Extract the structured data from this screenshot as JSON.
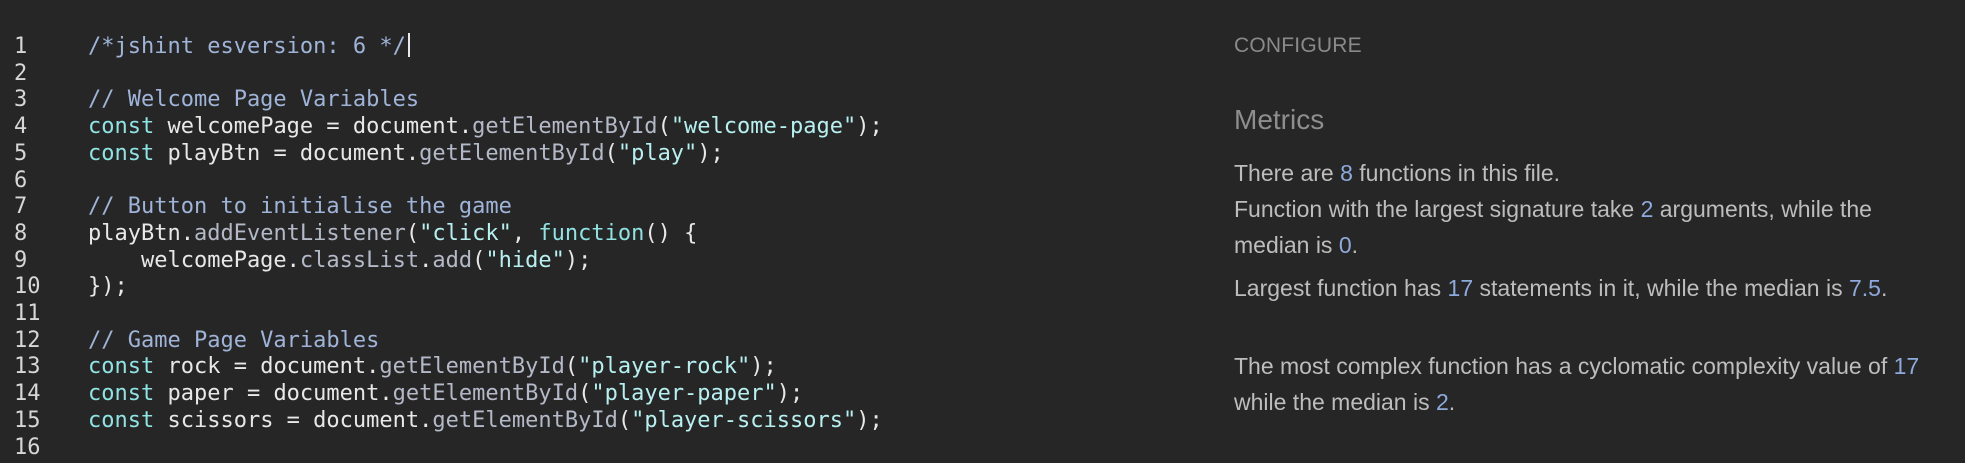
{
  "editor": {
    "lines": [
      {
        "num": "1",
        "tokens": [
          {
            "t": "/*jshint esversion: 6 */",
            "k": "comment"
          }
        ],
        "cursor": true
      },
      {
        "num": "2",
        "tokens": []
      },
      {
        "num": "3",
        "tokens": [
          {
            "t": "// Welcome Page Variables",
            "k": "comment"
          }
        ]
      },
      {
        "num": "4",
        "tokens": [
          {
            "t": "const",
            "k": "kw"
          },
          {
            "t": " welcomePage = document.",
            "k": "plain"
          },
          {
            "t": "getElementById",
            "k": "fn"
          },
          {
            "t": "(",
            "k": "plain"
          },
          {
            "t": "\"welcome-page\"",
            "k": "str"
          },
          {
            "t": ");",
            "k": "plain"
          }
        ]
      },
      {
        "num": "5",
        "tokens": [
          {
            "t": "const",
            "k": "kw"
          },
          {
            "t": " playBtn = document.",
            "k": "plain"
          },
          {
            "t": "getElementById",
            "k": "fn"
          },
          {
            "t": "(",
            "k": "plain"
          },
          {
            "t": "\"play\"",
            "k": "str"
          },
          {
            "t": ");",
            "k": "plain"
          }
        ]
      },
      {
        "num": "6",
        "tokens": []
      },
      {
        "num": "7",
        "tokens": [
          {
            "t": "// Button to initialise the game",
            "k": "comment"
          }
        ]
      },
      {
        "num": "8",
        "tokens": [
          {
            "t": "playBtn.",
            "k": "plain"
          },
          {
            "t": "addEventListener",
            "k": "fn"
          },
          {
            "t": "(",
            "k": "plain"
          },
          {
            "t": "\"click\"",
            "k": "str"
          },
          {
            "t": ", ",
            "k": "plain"
          },
          {
            "t": "function",
            "k": "kw"
          },
          {
            "t": "() {",
            "k": "plain"
          }
        ]
      },
      {
        "num": "9",
        "tokens": [
          {
            "t": "    welcomePage.",
            "k": "plain"
          },
          {
            "t": "classList",
            "k": "fn"
          },
          {
            "t": ".",
            "k": "plain"
          },
          {
            "t": "add",
            "k": "fn"
          },
          {
            "t": "(",
            "k": "plain"
          },
          {
            "t": "\"hide\"",
            "k": "str"
          },
          {
            "t": ");",
            "k": "plain"
          }
        ]
      },
      {
        "num": "10",
        "tokens": [
          {
            "t": "});",
            "k": "plain"
          }
        ]
      },
      {
        "num": "11",
        "tokens": []
      },
      {
        "num": "12",
        "tokens": [
          {
            "t": "// Game Page Variables",
            "k": "comment"
          }
        ]
      },
      {
        "num": "13",
        "tokens": [
          {
            "t": "const",
            "k": "kw"
          },
          {
            "t": " rock = document.",
            "k": "plain"
          },
          {
            "t": "getElementById",
            "k": "fn"
          },
          {
            "t": "(",
            "k": "plain"
          },
          {
            "t": "\"player-rock\"",
            "k": "str"
          },
          {
            "t": ");",
            "k": "plain"
          }
        ]
      },
      {
        "num": "14",
        "tokens": [
          {
            "t": "const",
            "k": "kw"
          },
          {
            "t": " paper = document.",
            "k": "plain"
          },
          {
            "t": "getElementById",
            "k": "fn"
          },
          {
            "t": "(",
            "k": "plain"
          },
          {
            "t": "\"player-paper\"",
            "k": "str"
          },
          {
            "t": ");",
            "k": "plain"
          }
        ]
      },
      {
        "num": "15",
        "tokens": [
          {
            "t": "const",
            "k": "kw"
          },
          {
            "t": " scissors = document.",
            "k": "plain"
          },
          {
            "t": "getElementById",
            "k": "fn"
          },
          {
            "t": "(",
            "k": "plain"
          },
          {
            "t": "\"player-scissors\"",
            "k": "str"
          },
          {
            "t": ");",
            "k": "plain"
          }
        ]
      },
      {
        "num": "16",
        "tokens": []
      }
    ]
  },
  "panel": {
    "configure_label": "CONFIGURE",
    "heading": "Metrics",
    "metrics": [
      [
        {
          "t": "There are "
        },
        {
          "t": "8",
          "n": true
        },
        {
          "t": " functions in this file."
        }
      ],
      [
        {
          "t": "Function with the largest signature take "
        },
        {
          "t": "2",
          "n": true
        },
        {
          "t": " arguments, while the median is "
        },
        {
          "t": "0",
          "n": true
        },
        {
          "t": "."
        }
      ],
      [
        {
          "t": "Largest function has "
        },
        {
          "t": "17",
          "n": true
        },
        {
          "t": " statements in it, while the median is "
        },
        {
          "t": "7.5",
          "n": true
        },
        {
          "t": "."
        }
      ],
      [
        {
          "t": "The most complex function has a cyclomatic complexity value of "
        },
        {
          "t": "17",
          "n": true
        },
        {
          "t": " while the median is "
        },
        {
          "t": "2",
          "n": true
        },
        {
          "t": "."
        }
      ]
    ]
  },
  "colors": {
    "background": "#262626",
    "comment": "#9fb4d8",
    "keyword": "#8fe3e3",
    "string": "#b7f0f0",
    "number_highlight": "#8ea9dc"
  }
}
